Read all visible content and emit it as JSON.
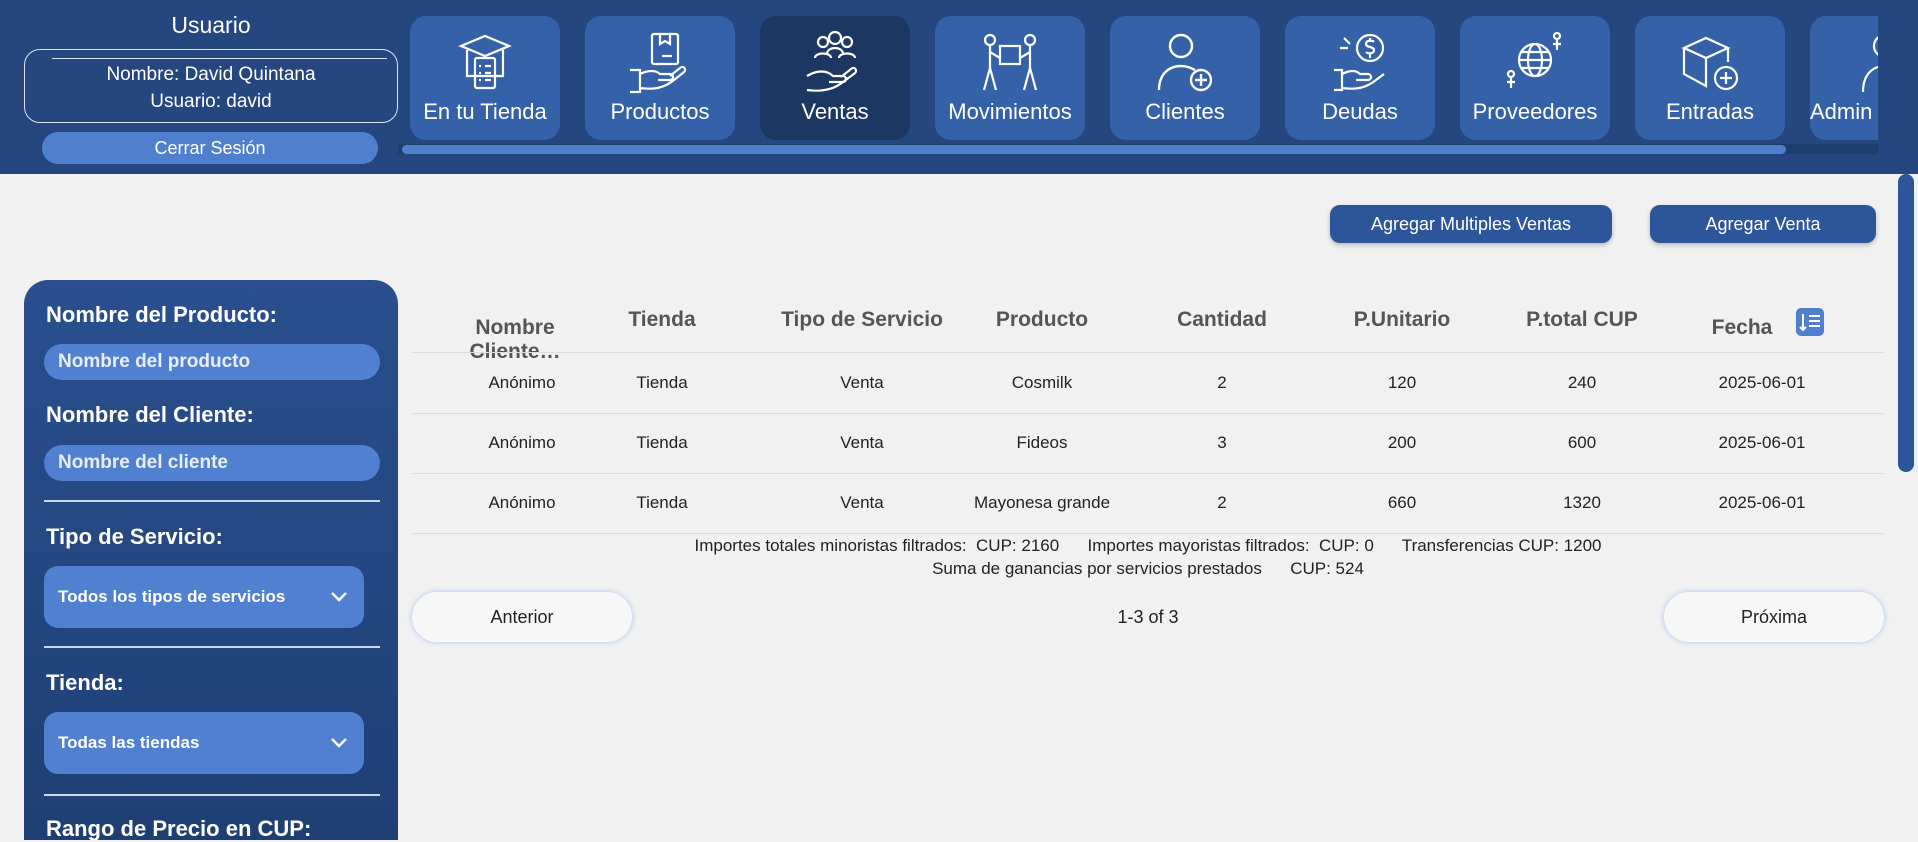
{
  "user": {
    "title": "Usuario",
    "name_line": "Nombre: David Quintana",
    "user_line": "Usuario: david",
    "logout": "Cerrar Sesión"
  },
  "nav": [
    {
      "label": "En tu Tienda",
      "icon": "box-checklist-icon"
    },
    {
      "label": "Productos",
      "icon": "hand-box-icon"
    },
    {
      "label": "Ventas",
      "icon": "hand-people-icon"
    },
    {
      "label": "Movimientos",
      "icon": "people-carry-box-icon"
    },
    {
      "label": "Clientes",
      "icon": "user-add-icon"
    },
    {
      "label": "Deudas",
      "icon": "money-hand-icon"
    },
    {
      "label": "Proveedores",
      "icon": "globe-people-icon"
    },
    {
      "label": "Entradas",
      "icon": "box-add-icon"
    },
    {
      "label": "Admin",
      "icon": "admin-user-icon"
    }
  ],
  "actions": {
    "multi": "Agregar Multiples Ventas",
    "single": "Agregar Venta"
  },
  "filters": {
    "product_label": "Nombre del Producto:",
    "product_placeholder": "Nombre del producto",
    "client_label": "Nombre del Cliente:",
    "client_placeholder": "Nombre del cliente",
    "service_label": "Tipo de Servicio:",
    "service_value": "Todos los tipos de servicios",
    "store_label": "Tienda:",
    "store_value": "Todas las tiendas",
    "price_label": "Rango de Precio en CUP:"
  },
  "table": {
    "headers": [
      "Nombre Cliente…",
      "Tienda",
      "Tipo de Servicio",
      "Producto",
      "Cantidad",
      "P.Unitario",
      "P.total CUP",
      "Fecha"
    ],
    "rows": [
      [
        "Anónimo",
        "Tienda",
        "Venta",
        "Cosmilk",
        "2",
        "120",
        "240",
        "2025-06-01"
      ],
      [
        "Anónimo",
        "Tienda",
        "Venta",
        "Fideos",
        "3",
        "200",
        "600",
        "2025-06-01"
      ],
      [
        "Anónimo",
        "Tienda",
        "Venta",
        "Mayonesa grande",
        "2",
        "660",
        "1320",
        "2025-06-01"
      ]
    ],
    "summary1": "Importes totales minoristas filtrados:  CUP: 2160      Importes mayoristas filtrados:  CUP: 0      Transferencias CUP: 1200",
    "summary2": "Suma de ganancias por servicios prestados      CUP: 524"
  },
  "pagination": {
    "prev": "Anterior",
    "info": "1-3 of 3",
    "next": "Próxima"
  },
  "colors": {
    "topbar": "#25467f",
    "tile": "#3461a8",
    "tile_active": "#1b3762",
    "accent": "#5080cf"
  }
}
